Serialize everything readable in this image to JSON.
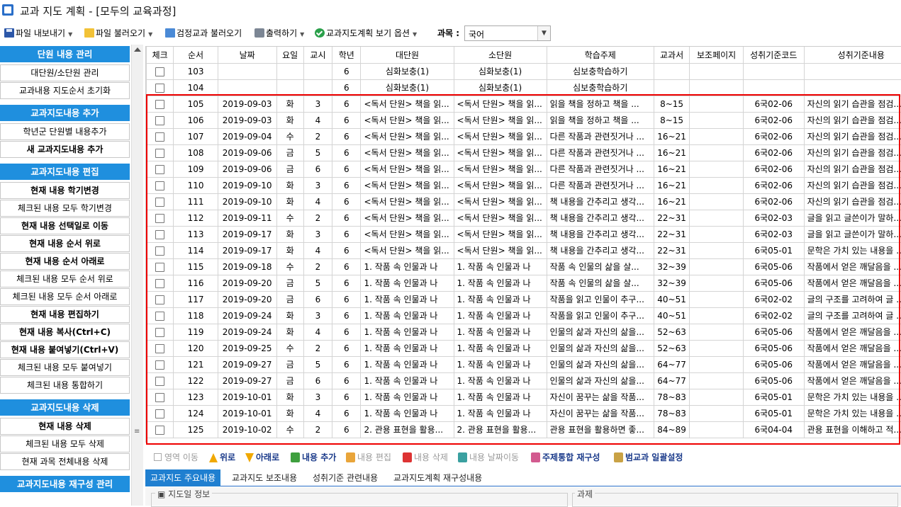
{
  "window": {
    "title": "교과 지도 계획 - [모두의 교육과정]"
  },
  "toolbar": {
    "export": "파일 내보내기",
    "import": "파일 불러오기",
    "textbook_import": "검정교과 불러오기",
    "print": "출력하기",
    "view_options": "교과지도계획 보기 옵션",
    "subject_label": "과목 :",
    "subject_value": "국어"
  },
  "sidebar": {
    "sections": [
      {
        "header": "단원 내용 관리",
        "items": [
          {
            "label": "대단원/소단원 관리",
            "bold": false
          },
          {
            "label": "교과내용 지도순서 초기화",
            "bold": false
          }
        ]
      },
      {
        "header": "교과지도내용 추가",
        "items": [
          {
            "label": "학년군 단원별 내용추가",
            "bold": false
          },
          {
            "label": "새 교과지도내용 추가",
            "bold": true
          }
        ]
      },
      {
        "header": "교과지도내용 편집",
        "items": [
          {
            "label": "현재 내용 학기변경",
            "bold": true
          },
          {
            "label": "체크된 내용 모두 학기변경",
            "bold": false
          },
          {
            "label": "현재 내용 선택일로 이동",
            "bold": true
          },
          {
            "label": "현재 내용 순서 위로",
            "bold": true
          },
          {
            "label": "현재 내용 순서 아래로",
            "bold": true
          },
          {
            "label": "체크된 내용 모두 순서 위로",
            "bold": false
          },
          {
            "label": "체크된 내용 모두 순서 아래로",
            "bold": false
          },
          {
            "label": "현재 내용 편집하기",
            "bold": true
          },
          {
            "label": "현재 내용 복사(Ctrl+C)",
            "bold": true
          },
          {
            "label": "현재 내용 붙여넣기(Ctrl+V)",
            "bold": true
          },
          {
            "label": "체크된 내용 모두 붙여넣기",
            "bold": false
          },
          {
            "label": "체크된 내용 통합하기",
            "bold": false
          }
        ]
      },
      {
        "header": "교과지도내용 삭제",
        "items": [
          {
            "label": "현재 내용 삭제",
            "bold": true
          },
          {
            "label": "체크된 내용 모두 삭제",
            "bold": false
          },
          {
            "label": "현재 과목 전체내용 삭제",
            "bold": false
          }
        ]
      },
      {
        "header": "교과지도내용 재구성 관리",
        "items": []
      }
    ]
  },
  "grid": {
    "columns": [
      "체크",
      "순서",
      "날짜",
      "요일",
      "교시",
      "학년",
      "대단원",
      "소단원",
      "학습주제",
      "교과서",
      "보조페이지",
      "성취기준코드",
      "성취기준내용"
    ],
    "rows": [
      [
        "103",
        "",
        "",
        "",
        "6",
        "심화보충(1)",
        "심화보충(1)",
        "심보충학습하기",
        "",
        "",
        "",
        ""
      ],
      [
        "104",
        "",
        "",
        "",
        "6",
        "심화보충(1)",
        "심화보충(1)",
        "심보충학습하기",
        "",
        "",
        "",
        ""
      ],
      [
        "105",
        "2019-09-03",
        "화",
        "3",
        "6",
        "<독서 단원> 책을 읽...",
        "<독서 단원> 책을 읽...",
        "읽을 책을 정하고 책을 ...",
        "8~15",
        "",
        "6국02-06",
        "자신의 읽기 습관을 점검..."
      ],
      [
        "106",
        "2019-09-03",
        "화",
        "4",
        "6",
        "<독서 단원> 책을 읽...",
        "<독서 단원> 책을 읽...",
        "읽을 책을 정하고 책을 ...",
        "8~15",
        "",
        "6국02-06",
        "자신의 읽기 습관을 점검..."
      ],
      [
        "107",
        "2019-09-04",
        "수",
        "2",
        "6",
        "<독서 단원> 책을 읽...",
        "<독서 단원> 책을 읽...",
        "다른 작품과 관련짓거나 ...",
        "16~21",
        "",
        "6국02-06",
        "자신의 읽기 습관을 점검..."
      ],
      [
        "108",
        "2019-09-06",
        "금",
        "5",
        "6",
        "<독서 단원> 책을 읽...",
        "<독서 단원> 책을 읽...",
        "다른 작품과 관련짓거나 ...",
        "16~21",
        "",
        "6국02-06",
        "자신의 읽기 습관을 점검..."
      ],
      [
        "109",
        "2019-09-06",
        "금",
        "6",
        "6",
        "<독서 단원> 책을 읽...",
        "<독서 단원> 책을 읽...",
        "다른 작품과 관련짓거나 ...",
        "16~21",
        "",
        "6국02-06",
        "자신의 읽기 습관을 점검..."
      ],
      [
        "110",
        "2019-09-10",
        "화",
        "3",
        "6",
        "<독서 단원> 책을 읽...",
        "<독서 단원> 책을 읽...",
        "다른 작품과 관련짓거나 ...",
        "16~21",
        "",
        "6국02-06",
        "자신의 읽기 습관을 점검..."
      ],
      [
        "111",
        "2019-09-10",
        "화",
        "4",
        "6",
        "<독서 단원> 책을 읽...",
        "<독서 단원> 책을 읽...",
        "책 내용을 간추리고 생각...",
        "16~21",
        "",
        "6국02-06",
        "자신의 읽기 습관을 점검..."
      ],
      [
        "112",
        "2019-09-11",
        "수",
        "2",
        "6",
        "<독서 단원> 책을 읽...",
        "<독서 단원> 책을 읽...",
        "책 내용을 간추리고 생각...",
        "22~31",
        "",
        "6국02-03",
        "글을 읽고 글쓴이가 말하..."
      ],
      [
        "113",
        "2019-09-17",
        "화",
        "3",
        "6",
        "<독서 단원> 책을 읽...",
        "<독서 단원> 책을 읽...",
        "책 내용을 간추리고 생각...",
        "22~31",
        "",
        "6국02-03",
        "글을 읽고 글쓴이가 말하..."
      ],
      [
        "114",
        "2019-09-17",
        "화",
        "4",
        "6",
        "<독서 단원> 책을 읽...",
        "<독서 단원> 책을 읽...",
        "책 내용을 간추리고 생각...",
        "22~31",
        "",
        "6국05-01",
        "문학은 가치 있는 내용을 ..."
      ],
      [
        "115",
        "2019-09-18",
        "수",
        "2",
        "6",
        "1. 작품 속 인물과 나",
        "1. 작품 속 인물과 나",
        "작품 속 인물의 삶을 살...",
        "32~39",
        "",
        "6국05-06",
        "작품에서 얻은 깨달음을 ..."
      ],
      [
        "116",
        "2019-09-20",
        "금",
        "5",
        "6",
        "1. 작품 속 인물과 나",
        "1. 작품 속 인물과 나",
        "작품 속 인물의 삶을 살...",
        "32~39",
        "",
        "6국05-06",
        "작품에서 얻은 깨달음을 ..."
      ],
      [
        "117",
        "2019-09-20",
        "금",
        "6",
        "6",
        "1. 작품 속 인물과 나",
        "1. 작품 속 인물과 나",
        "작품을 읽고 인물이 추구...",
        "40~51",
        "",
        "6국02-02",
        "글의 구조를 고려하여 글 ..."
      ],
      [
        "118",
        "2019-09-24",
        "화",
        "3",
        "6",
        "1. 작품 속 인물과 나",
        "1. 작품 속 인물과 나",
        "작품을 읽고 인물이 추구...",
        "40~51",
        "",
        "6국02-02",
        "글의 구조를 고려하여 글 ..."
      ],
      [
        "119",
        "2019-09-24",
        "화",
        "4",
        "6",
        "1. 작품 속 인물과 나",
        "1. 작품 속 인물과 나",
        "인물의 삶과 자신의 삶을...",
        "52~63",
        "",
        "6국05-06",
        "작품에서 얻은 깨달음을 ..."
      ],
      [
        "120",
        "2019-09-25",
        "수",
        "2",
        "6",
        "1. 작품 속 인물과 나",
        "1. 작품 속 인물과 나",
        "인물의 삶과 자신의 삶을...",
        "52~63",
        "",
        "6국05-06",
        "작품에서 얻은 깨달음을 ..."
      ],
      [
        "121",
        "2019-09-27",
        "금",
        "5",
        "6",
        "1. 작품 속 인물과 나",
        "1. 작품 속 인물과 나",
        "인물의 삶과 자신의 삶을...",
        "64~77",
        "",
        "6국05-06",
        "작품에서 얻은 깨달음을 ..."
      ],
      [
        "122",
        "2019-09-27",
        "금",
        "6",
        "6",
        "1. 작품 속 인물과 나",
        "1. 작품 속 인물과 나",
        "인물의 삶과 자신의 삶을...",
        "64~77",
        "",
        "6국05-06",
        "작품에서 얻은 깨달음을 ..."
      ],
      [
        "123",
        "2019-10-01",
        "화",
        "3",
        "6",
        "1. 작품 속 인물과 나",
        "1. 작품 속 인물과 나",
        "자신이 꿈꾸는 삶을 작품...",
        "78~83",
        "",
        "6국05-01",
        "문학은 가치 있는 내용을 ..."
      ],
      [
        "124",
        "2019-10-01",
        "화",
        "4",
        "6",
        "1. 작품 속 인물과 나",
        "1. 작품 속 인물과 나",
        "자신이 꿈꾸는 삶을 작품...",
        "78~83",
        "",
        "6국05-01",
        "문학은 가치 있는 내용을 ..."
      ],
      [
        "125",
        "2019-10-02",
        "수",
        "2",
        "6",
        "2. 관용 표현을 활용...",
        "2. 관용 표현을 활용...",
        "관용 표현을 활용하면 좋...",
        "84~89",
        "",
        "6국04-04",
        "관용 표현을 이해하고 적..."
      ]
    ]
  },
  "actions": {
    "area_move": "영역 이동",
    "up": "위로",
    "down": "아래로",
    "add": "내용 추가",
    "edit": "내용 편집",
    "delete": "내용 삭제",
    "date_move": "내용 날짜이동",
    "theme_merge": "주제통합 재구성",
    "cross_subject": "범교과 일괄설정"
  },
  "tabs": [
    "교과지도 주요내용",
    "교과지도 보조내용",
    "성취기준 관련내용",
    "교과지도계획 재구성내용"
  ],
  "panel": {
    "guide_date_label": "지도일 정보",
    "task_label": "과제"
  },
  "colors": {
    "sidebar_header": "#1f8fde",
    "highlight_border": "#e00000",
    "active_tab": "#1f7fd0"
  }
}
